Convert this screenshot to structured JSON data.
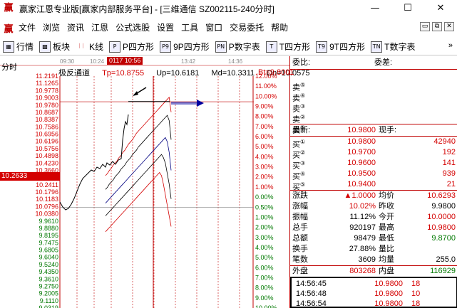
{
  "window": {
    "app_icon": "赢",
    "title": "赢家江恩专业版[赢家内部服务平台] - [三维通信  SZ002115-240分时]",
    "controls": [
      "—",
      "☐",
      "✕"
    ]
  },
  "menu": {
    "icon": "赢",
    "items": [
      "文件",
      "浏览",
      "资讯",
      "江恩",
      "公式选股",
      "设置",
      "工具",
      "窗口",
      "交易委托",
      "帮助"
    ],
    "mdi": [
      "▭",
      "⧉",
      "✕"
    ]
  },
  "toolbar": {
    "buttons": [
      {
        "icon": "▦",
        "label": "行情"
      },
      {
        "icon": "▩",
        "label": "板块"
      },
      {
        "icon": "ᛁᛁ",
        "label": "K线"
      },
      {
        "icon": "P",
        "label": "P四方形"
      },
      {
        "icon": "P9",
        "label": "9P四方形"
      },
      {
        "icon": "PN",
        "label": "P数字表"
      },
      {
        "icon": "T",
        "label": "T四方形"
      },
      {
        "icon": "T9",
        "label": "9T四方形"
      },
      {
        "icon": "TN",
        "label": "T数字表"
      }
    ],
    "more": "»"
  },
  "chart": {
    "fenshi_label": "分时",
    "time_ticks": [
      "09:30",
      "10:24",
      "13:42",
      "14:36"
    ],
    "cursor_time": "0117 10:56",
    "indicator": {
      "name": "极反通道",
      "tp": "Tp=10.8755",
      "up": "Up=10.6181",
      "md": "Md=10.3311",
      "dn": "Dn=10.0575",
      "bt": "Bt=9.8001"
    },
    "price_tag": "10.2633",
    "left_axis": [
      "11.2191",
      "11.1265",
      "10.9778",
      "10.9003",
      "10.9780",
      "10.8687",
      "10.8387",
      "10.7586",
      "10.6956",
      "10.6196",
      "10.5756",
      "10.4898",
      "10.4230",
      "10.3660",
      "10.3070",
      "10.2411",
      "10.1796",
      "10.1183",
      "10.0796",
      "10.0380",
      "9.9610",
      "9.8880",
      "9.8195",
      "9.7475",
      "9.6805",
      "9.6040",
      "9.5240",
      "9.4350",
      "9.3610",
      "9.2750",
      "9.2005",
      "9.1110",
      "9.0319"
    ],
    "right_axis": [
      "12.00%",
      "11.00%",
      "10.00%",
      "9.00%",
      "8.00%",
      "7.00%",
      "6.00%",
      "5.00%",
      "4.00%",
      "3.00%",
      "2.00%",
      "1.00%",
      "0.00%",
      "0.50%",
      "1.00%",
      "2.00%",
      "3.00%",
      "4.00%",
      "5.00%",
      "6.00%",
      "7.00%",
      "8.00%",
      "9.00%",
      "10.00%"
    ],
    "colors": {
      "up": "#d40000",
      "down": "#007800",
      "grid": "#c00000"
    }
  },
  "chart_data": {
    "type": "line",
    "title": "极反通道",
    "x": [
      0,
      1,
      2,
      3,
      4,
      5,
      6,
      7,
      8,
      9,
      10,
      11,
      12,
      13,
      14,
      15,
      16,
      17,
      18,
      19,
      20,
      21,
      22,
      23,
      24,
      25,
      26,
      27,
      28,
      29,
      30,
      31,
      32,
      33,
      34
    ],
    "series": [
      {
        "name": "Tp",
        "values": [
          10.28,
          10.3,
          10.33,
          10.35,
          10.38,
          10.4,
          10.42,
          10.45,
          10.47,
          10.5,
          10.52,
          10.55,
          10.58,
          10.6,
          10.62,
          10.65,
          10.68,
          10.7,
          10.72,
          10.74,
          10.76,
          10.78,
          10.8,
          10.82,
          10.84,
          10.86,
          10.88,
          10.9,
          10.92,
          10.94,
          10.96,
          10.98,
          11.0,
          11.02,
          10.88
        ]
      },
      {
        "name": "Up",
        "values": [
          10.15,
          10.17,
          10.2,
          10.22,
          10.24,
          10.27,
          10.29,
          10.31,
          10.34,
          10.36,
          10.38,
          10.41,
          10.43,
          10.45,
          10.48,
          10.5,
          10.52,
          10.55,
          10.57,
          10.59,
          10.61,
          10.63,
          10.65,
          10.67,
          10.69,
          10.71,
          10.73,
          10.75,
          10.77,
          10.79,
          10.81,
          10.83,
          10.85,
          10.8,
          10.62
        ]
      },
      {
        "name": "Md",
        "values": [
          10.02,
          10.04,
          10.06,
          10.08,
          10.1,
          10.12,
          10.14,
          10.16,
          10.18,
          10.2,
          10.22,
          10.24,
          10.26,
          10.28,
          10.3,
          10.32,
          10.34,
          10.36,
          10.38,
          10.4,
          10.42,
          10.44,
          10.46,
          10.48,
          10.5,
          10.52,
          10.54,
          10.56,
          10.58,
          10.6,
          10.62,
          10.64,
          10.6,
          10.5,
          10.33
        ]
      },
      {
        "name": "Dn",
        "values": [
          9.9,
          9.92,
          9.94,
          9.96,
          9.98,
          10.0,
          10.02,
          10.04,
          10.06,
          10.08,
          10.1,
          10.12,
          10.14,
          10.16,
          10.18,
          10.2,
          10.22,
          10.24,
          10.26,
          10.28,
          10.3,
          10.32,
          10.34,
          10.36,
          10.38,
          10.4,
          10.42,
          10.44,
          10.46,
          10.48,
          10.45,
          10.4,
          10.3,
          10.2,
          10.06
        ]
      },
      {
        "name": "Bt",
        "values": [
          9.75,
          9.77,
          9.79,
          9.81,
          9.83,
          9.85,
          9.87,
          9.89,
          9.91,
          9.93,
          9.95,
          9.97,
          9.99,
          10.01,
          10.03,
          10.05,
          10.07,
          10.09,
          10.11,
          10.13,
          10.15,
          10.17,
          10.19,
          10.21,
          10.23,
          10.25,
          10.27,
          10.29,
          10.31,
          10.28,
          10.2,
          10.1,
          10.0,
          9.9,
          9.8
        ]
      }
    ],
    "ylim": [
      9.03,
      11.22
    ]
  },
  "panel": {
    "weibi_label": "委比:",
    "weicha_label": "委差:",
    "sell_label": "卖",
    "sell_marks": [
      "⑤",
      "④",
      "③",
      "②",
      "①"
    ],
    "last_label": "最新:",
    "last_value": "10.9800",
    "xianshou_label": "现手:",
    "buys": [
      {
        "label": "买",
        "mark": "①",
        "price": "10.9800",
        "vol": "42940"
      },
      {
        "label": "买",
        "mark": "②",
        "price": "10.9700",
        "vol": "192"
      },
      {
        "label": "买",
        "mark": "③",
        "price": "10.9600",
        "vol": "141"
      },
      {
        "label": "买",
        "mark": "④",
        "price": "10.9500",
        "vol": "939"
      },
      {
        "label": "买",
        "mark": "⑤",
        "price": "10.9400",
        "vol": "21"
      }
    ],
    "stats": [
      {
        "l1": "涨跌",
        "v1": "▲1.0000",
        "l2": "均价",
        "v2": "10.6293",
        "c1": "red",
        "c2": "red"
      },
      {
        "l1": "涨幅",
        "v1": "10.02%",
        "l2": "昨收",
        "v2": "9.9800",
        "c1": "red",
        "c2": ""
      },
      {
        "l1": "振幅",
        "v1": "11.12%",
        "l2": "今开",
        "v2": "10.0000",
        "c1": "",
        "c2": "red"
      },
      {
        "l1": "总手",
        "v1": "920197",
        "l2": "最高",
        "v2": "10.9800",
        "c1": "",
        "c2": "red"
      },
      {
        "l1": "总额",
        "v1": "98479",
        "l2": "最低",
        "v2": "9.8700",
        "c1": "",
        "c2": "green"
      },
      {
        "l1": "换手",
        "v1": "27.88%",
        "l2": "量比",
        "v2": "",
        "c1": "",
        "c2": ""
      },
      {
        "l1": "笔数",
        "v1": "3609",
        "l2": "均量",
        "v2": "255.0",
        "c1": "",
        "c2": ""
      }
    ],
    "waipan_label": "外盘",
    "waipan_value": "803268",
    "neipan_label": "内盘",
    "neipan_value": "116929",
    "ticks": [
      {
        "time": "14:56:45",
        "price": "10.9800",
        "vol": "18"
      },
      {
        "time": "14:56:48",
        "price": "10.9800",
        "vol": "10"
      },
      {
        "time": "14:56:54",
        "price": "10.9800",
        "vol": "18"
      }
    ]
  }
}
